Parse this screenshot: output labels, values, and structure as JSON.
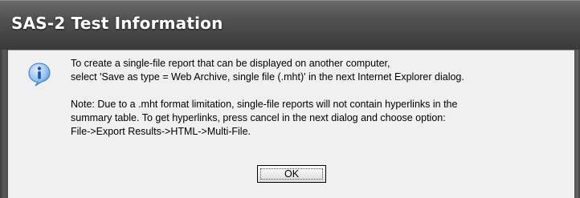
{
  "window": {
    "title": "SAS-2 Test Information"
  },
  "icon": {
    "name": "information-icon",
    "glyph": "i",
    "color": "#2c6fc2"
  },
  "message": {
    "line1": "To create a single-file report that can be displayed on another computer,",
    "line2": "select 'Save as type = Web Archive, single file (.mht)' in the next Internet Explorer dialog.",
    "line3": "Note: Due to a .mht format limitation, single-file reports will not contain hyperlinks in the",
    "line4": "summary table. To get hyperlinks, press cancel in the next dialog and choose option:",
    "line5": "File->Export Results->HTML->Multi-File."
  },
  "buttons": {
    "ok_label": "OK"
  }
}
